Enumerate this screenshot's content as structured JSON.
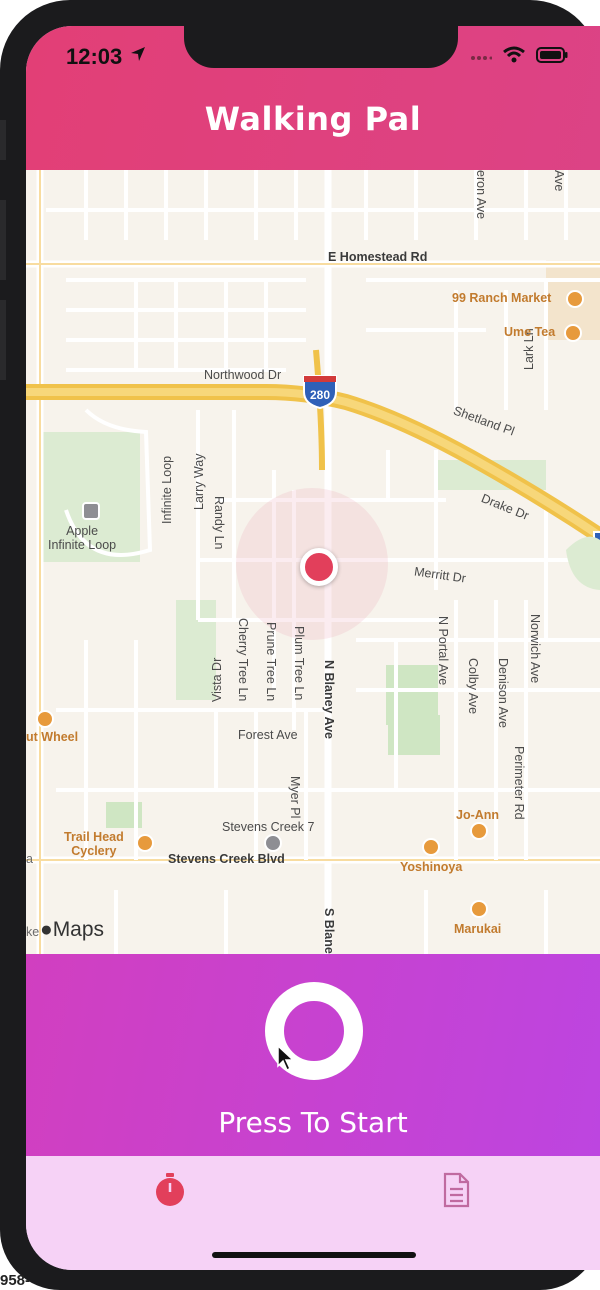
{
  "status_bar": {
    "time": "12:03"
  },
  "app": {
    "title": "Walking Pal"
  },
  "map": {
    "roads": {
      "e_homestead": "E Homestead Rd",
      "northwood": "Northwood Dr",
      "shetland": "Shetland Pl",
      "lark": "Lark Ln",
      "larry": "Larry Way",
      "randy": "Randy Ln",
      "infinite_loop": "Infinite Loop",
      "drake": "Drake Dr",
      "merritt": "Merritt Dr",
      "cherry_tree": "Cherry Tree Ln",
      "prune_tree": "Prune Tree Ln",
      "plum_tree": "Plum Tree Ln",
      "vista": "Vista Dr",
      "n_blaney": "N Blaney Ave",
      "n_portal": "N Portal Ave",
      "colby": "Colby Ave",
      "denison": "Denison Ave",
      "norwich": "Norwich Ave",
      "perimeter": "Perimeter Rd",
      "forest": "Forest Ave",
      "myer": "Myer Pl",
      "stevens_creek_blvd": "Stevens Creek Blvd",
      "s_blaney": "S Blaney",
      "heron": "eron Ave",
      "top_ave": "Ave"
    },
    "pois": {
      "ranch_99": "99 Ranch Market",
      "ume_tea": "Ume Tea",
      "apple": "Apple\nInfinite Loop",
      "donut_wheel": "ut Wheel",
      "trail_head": "Trail Head\nCyclery",
      "stevens_creek_7": "Stevens Creek 7",
      "jo_ann": "Jo-Ann",
      "yoshinoya": "Yoshinoya",
      "marukai": "Marukai"
    },
    "interstate": "280",
    "attribution": "Maps",
    "edge_labels": {
      "left_a": "a",
      "left_ke": "ke"
    }
  },
  "control": {
    "start_label": "Press To Start"
  },
  "tabs": [
    {
      "icon": "stopwatch-icon"
    },
    {
      "icon": "document-icon"
    }
  ],
  "corner_text": "958-",
  "colors": {
    "header": "#e23f76",
    "panel": "#c742d6",
    "tabbar": "#f6d2f6",
    "accent": "#e23f5b"
  }
}
